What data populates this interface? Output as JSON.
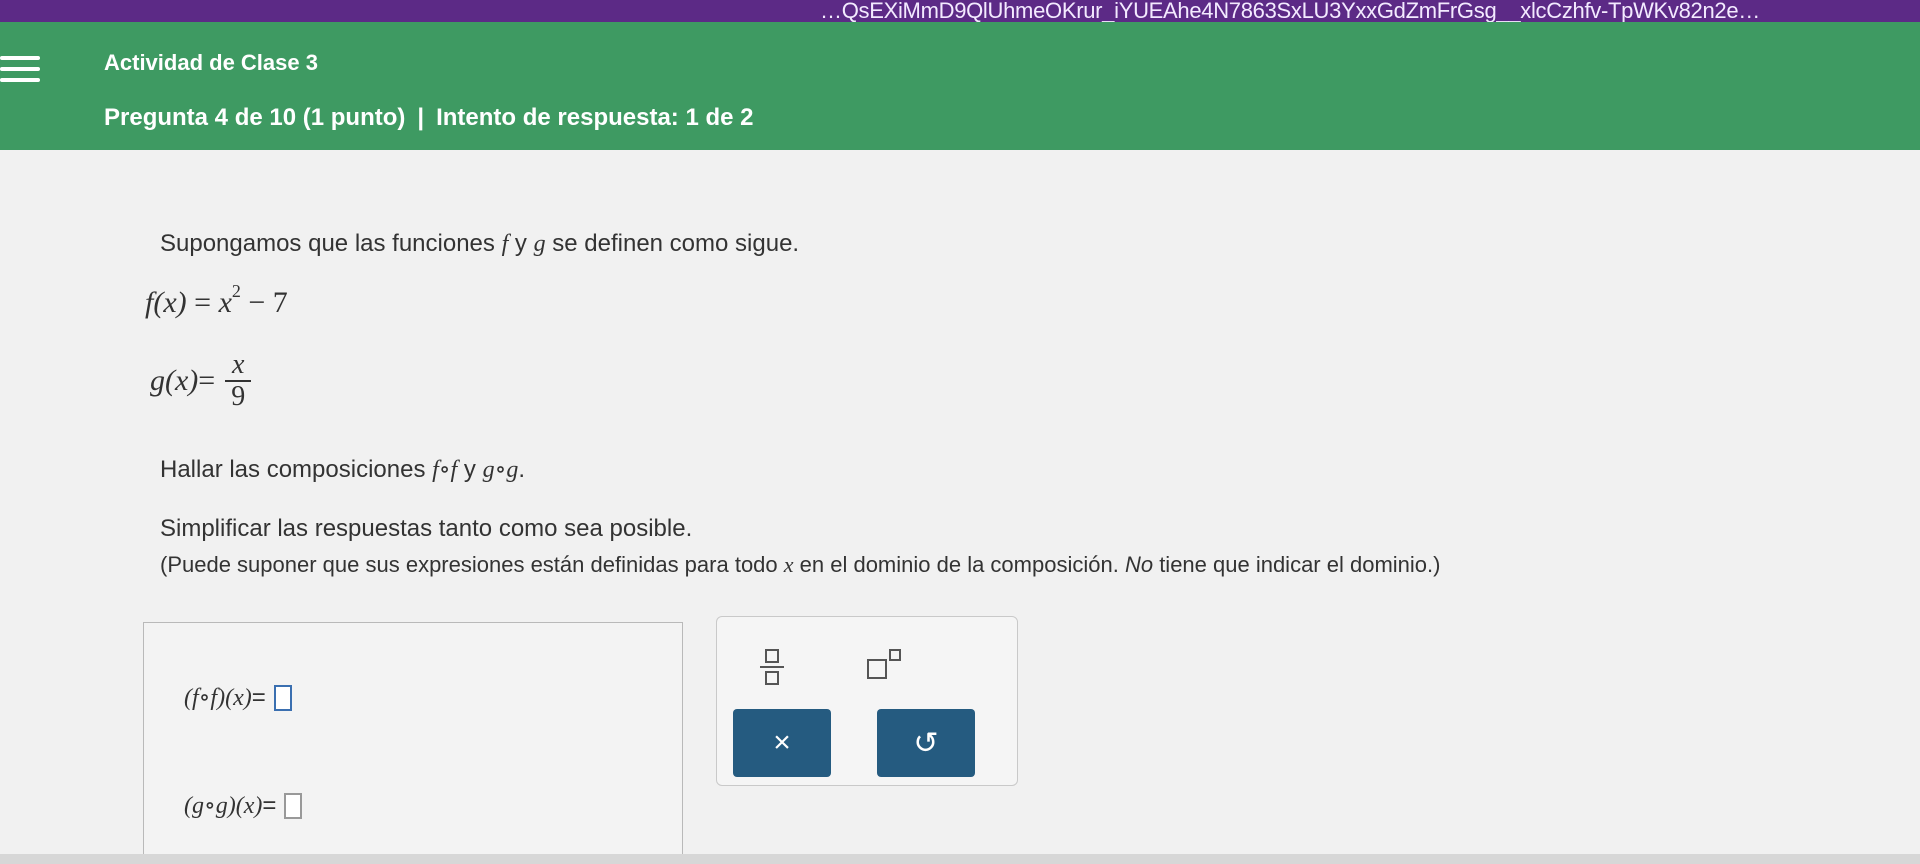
{
  "browser": {
    "url": "…QsEXiMmD9QlUhmeOKrur_iYUEAhe4N7863SxLU3YxxGdZmFrGsg__xlcCzhfv-TpWKv82n2e…"
  },
  "header": {
    "title": "Actividad de Clase 3",
    "question_info": "Pregunta 4 de 10 (1 punto)",
    "separator": "|",
    "attempt_info": "Intento de respuesta: 1 de 2"
  },
  "problem": {
    "intro_before": "Supongamos que las funciones ",
    "intro_f": "f",
    "intro_y": " y ",
    "intro_g": "g",
    "intro_after": " se definen como sigue.",
    "f_lhs": "f(x)",
    "f_eq": " = ",
    "f_base": "x",
    "f_exp": "2",
    "f_rest": " − 7",
    "g_lhs": "g(x)",
    "g_eq": " = ",
    "g_num": "x",
    "g_den": "9",
    "comp_before": "Hallar las composiciones ",
    "comp_fof": "f∘f",
    "comp_y": " y ",
    "comp_gog": "g∘g",
    "comp_after": ".",
    "simplify": "Simplificar las respuestas tanto como sea posible.",
    "note_before": "(Puede suponer que sus expresiones están definidas para todo ",
    "note_x": "x",
    "note_mid": " en el dominio de la composición. ",
    "note_italic": "No",
    "note_after": " tiene que indicar el dominio.)"
  },
  "answers": {
    "fof_label": "(f∘f)(x)",
    "gog_label": "(g∘g)(x)",
    "equals": " = "
  },
  "toolbar": {
    "clear_symbol": "×",
    "undo_symbol": "↺"
  },
  "colors": {
    "header_bg": "#3e9a62",
    "url_bar_bg": "#5c2a86",
    "button_bg": "#255b80"
  }
}
